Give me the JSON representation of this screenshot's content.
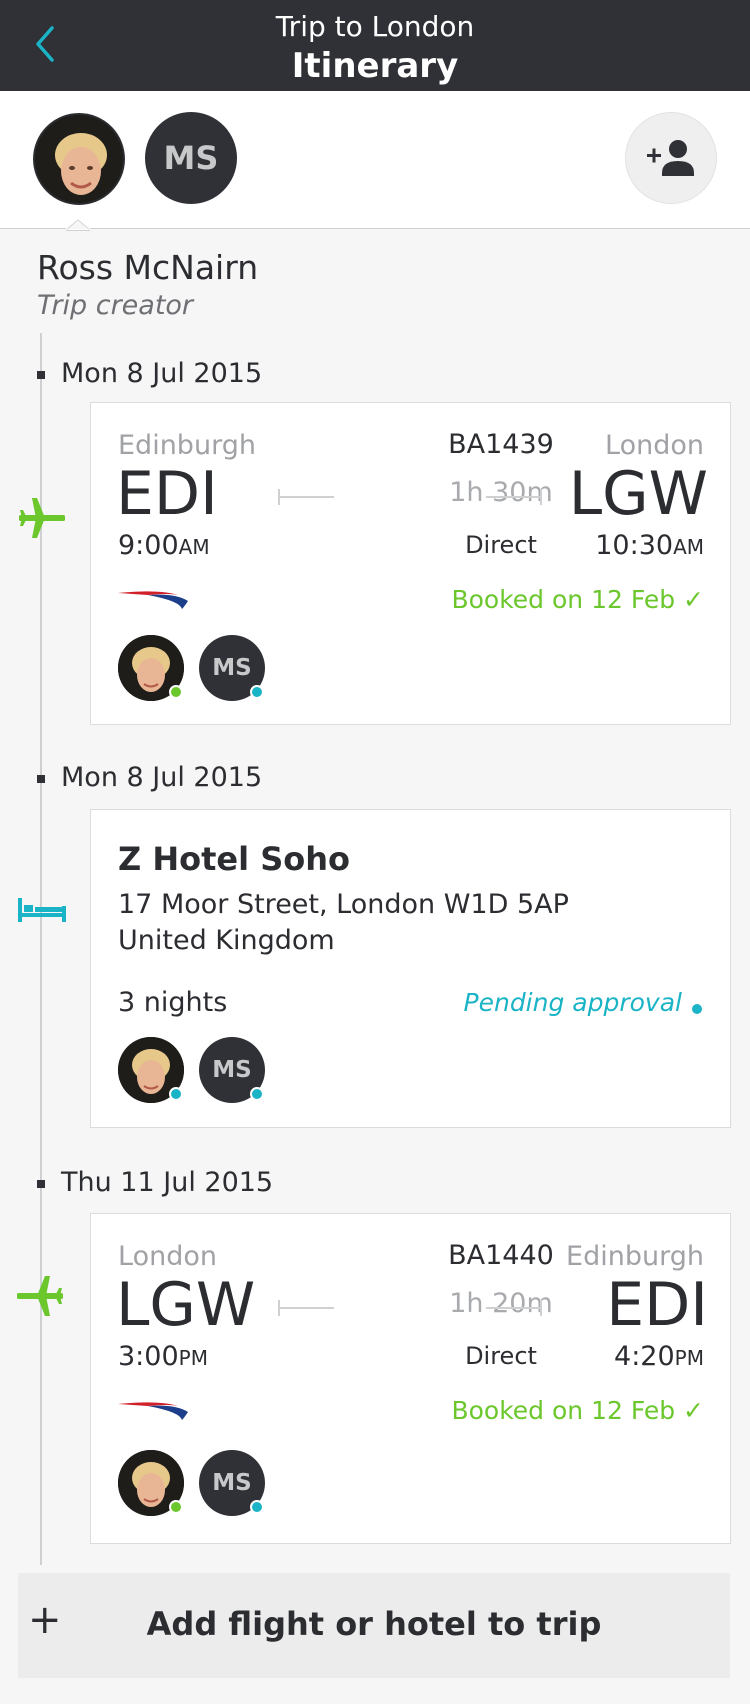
{
  "header": {
    "subtitle": "Trip to London",
    "title": "Itinerary"
  },
  "people": {
    "second_initials": "MS"
  },
  "creator": {
    "name": "Ross McNairn",
    "role": "Trip creator"
  },
  "items": [
    {
      "date": "Mon 8 Jul 2015",
      "type": "flight",
      "from_city": "Edinburgh",
      "from_code": "EDI",
      "dep_time": "9:00",
      "dep_ampm": "AM",
      "flight_no": "BA1439",
      "duration": "1h 30m",
      "stops": "Direct",
      "to_city": "London",
      "to_code": "LGW",
      "arr_time": "10:30",
      "arr_ampm": "AM",
      "status": "Booked on 12 Feb ✓",
      "traveler_initials": "MS"
    },
    {
      "date": "Mon 8 Jul 2015",
      "type": "hotel",
      "name": "Z Hotel Soho",
      "address_line1": "17 Moor Street, London W1D 5AP",
      "address_line2": "United Kingdom",
      "nights": "3 nights",
      "status": "Pending approval",
      "traveler_initials": "MS"
    },
    {
      "date": "Thu 11 Jul 2015",
      "type": "flight",
      "from_city": "London",
      "from_code": "LGW",
      "dep_time": "3:00",
      "dep_ampm": "PM",
      "flight_no": "BA1440",
      "duration": "1h 20m",
      "stops": "Direct",
      "to_city": "Edinburgh",
      "to_code": "EDI",
      "arr_time": "4:20",
      "arr_ampm": "PM",
      "status": "Booked on 12 Feb ✓",
      "traveler_initials": "MS"
    }
  ],
  "add_bar": {
    "icon": "+",
    "label": "Add flight or hotel to trip"
  },
  "colors": {
    "header_bg": "#2f3136",
    "accent_cyan": "#1bb3c6",
    "booked_green": "#6bc72c",
    "flight_icon_green": "#6bc72c"
  }
}
